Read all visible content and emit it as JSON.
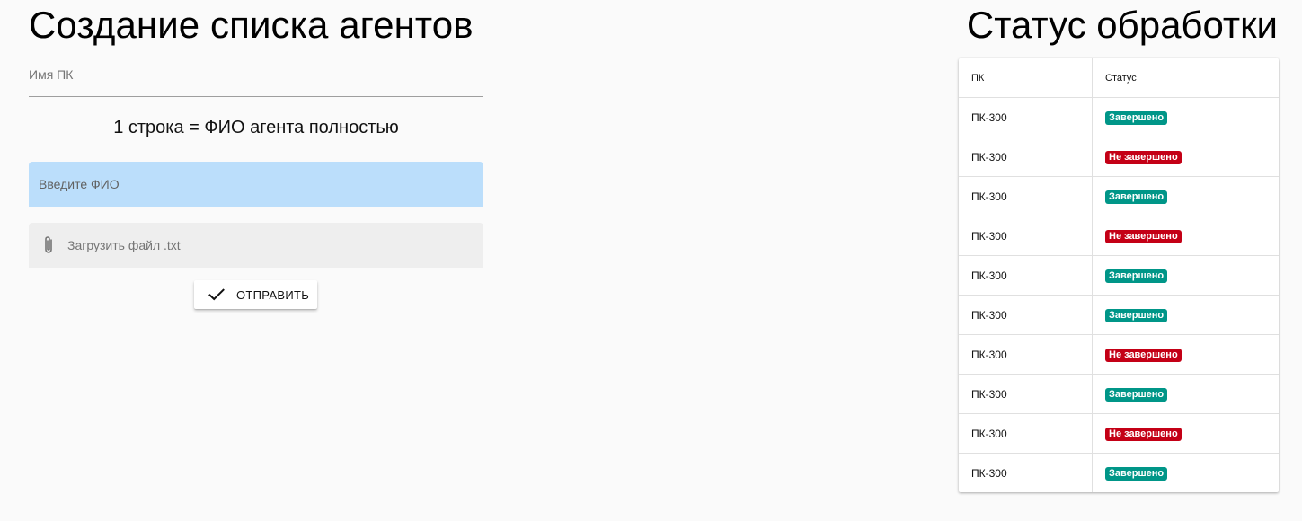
{
  "create_form": {
    "title": "Создание списка агентов",
    "pc_name_placeholder": "Имя ПК",
    "hint": "1 строка = ФИО агента полностью",
    "fio_placeholder": "Введите ФИО",
    "file_label": "Загрузить файл .txt",
    "send_label": "ОТПРАВИТЬ"
  },
  "status_panel": {
    "title": "Статус обработки",
    "columns": [
      "ПК",
      "Статус"
    ],
    "rows": [
      {
        "pc": "ПК-300",
        "status": "Завершено",
        "state": "done"
      },
      {
        "pc": "ПК-300",
        "status": "Не завершено",
        "state": "fail"
      },
      {
        "pc": "ПК-300",
        "status": "Завершено",
        "state": "done"
      },
      {
        "pc": "ПК-300",
        "status": "Не завершено",
        "state": "fail"
      },
      {
        "pc": "ПК-300",
        "status": "Завершено",
        "state": "done"
      },
      {
        "pc": "ПК-300",
        "status": "Завершено",
        "state": "done"
      },
      {
        "pc": "ПК-300",
        "status": "Не завершено",
        "state": "fail"
      },
      {
        "pc": "ПК-300",
        "status": "Завершено",
        "state": "done"
      },
      {
        "pc": "ПК-300",
        "status": "Не завершено",
        "state": "fail"
      },
      {
        "pc": "ПК-300",
        "status": "Завершено",
        "state": "done"
      }
    ]
  },
  "colors": {
    "done": "#009688",
    "fail": "#c40016",
    "fio_field_bg": "#bbdefb",
    "file_field_bg": "#eeeeee",
    "page_bg": "#fafafa"
  },
  "icons": {
    "file_field": "paperclip-icon",
    "send_button": "checkmark-icon"
  }
}
